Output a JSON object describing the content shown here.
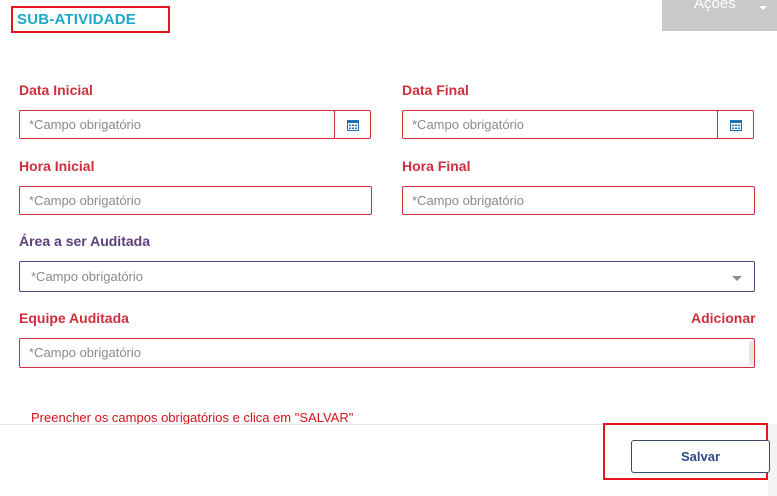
{
  "header": {
    "title": "SUB-ATIVIDADE",
    "actions_label": "Ações"
  },
  "form": {
    "data_inicial": {
      "label": "Data Inicial",
      "placeholder": "*Campo obrigatório"
    },
    "data_final": {
      "label": "Data Final",
      "placeholder": "*Campo obrigatório"
    },
    "hora_inicial": {
      "label": "Hora Inicial",
      "placeholder": "*Campo obrigatório"
    },
    "hora_final": {
      "label": "Hora Final",
      "placeholder": "*Campo obrigatório"
    },
    "area": {
      "label": "Área a ser Auditada",
      "placeholder": "*Campo obrigatório"
    },
    "equipe": {
      "label": "Equipe Auditada",
      "add_label": "Adicionar",
      "placeholder": "*Campo obrigatório"
    }
  },
  "footer": {
    "message": "Preencher os campos obrigatórios e clica em \"SALVAR\"",
    "save_label": "Salvar"
  },
  "colors": {
    "title": "#1fa8c9",
    "required_label": "#cf2f3c",
    "area_label": "#5e3e7c",
    "highlight": "#e8141c",
    "actions_bg": "#c9c9c9"
  }
}
